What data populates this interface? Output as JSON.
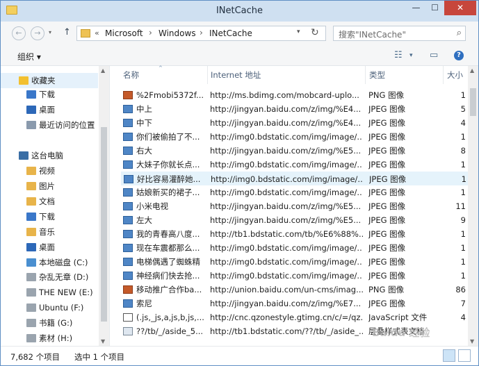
{
  "window": {
    "title": "INetCache"
  },
  "titlebar": {
    "min": "—",
    "max": "☐",
    "close": "✕"
  },
  "address": {
    "back": "←",
    "forward": "→",
    "up": "↑",
    "chevron": "«",
    "crumbs": [
      "Microsoft",
      "Windows",
      "INetCache"
    ],
    "separator": "›",
    "refresh": "↻",
    "dropdown": "▾"
  },
  "search": {
    "placeholder": "搜索\"INetCache\"",
    "icon": "⌕"
  },
  "toolbar": {
    "organize": "组织 ▾",
    "help": "?"
  },
  "nav": {
    "items": [
      {
        "label": "收藏夹",
        "icon": "star-icon",
        "color": "#f2c030"
      },
      {
        "label": "下载",
        "icon": "download-folder-icon",
        "color": "#3a77c9"
      },
      {
        "label": "桌面",
        "icon": "desktop-icon",
        "color": "#2d68b8"
      },
      {
        "label": "最近访问的位置",
        "icon": "recent-places-icon",
        "color": "#8a9aad"
      },
      {
        "label": "这台电脑",
        "icon": "computer-icon",
        "color": "#3a6ea5"
      },
      {
        "label": "视频",
        "icon": "videos-folder-icon",
        "color": "#e8b44a"
      },
      {
        "label": "图片",
        "icon": "pictures-folder-icon",
        "color": "#e8b44a"
      },
      {
        "label": "文档",
        "icon": "documents-folder-icon",
        "color": "#e8b44a"
      },
      {
        "label": "下载",
        "icon": "downloads-folder-icon",
        "color": "#3a77c9"
      },
      {
        "label": "音乐",
        "icon": "music-folder-icon",
        "color": "#e8b44a"
      },
      {
        "label": "桌面",
        "icon": "desktop-folder-icon",
        "color": "#2d68b8"
      },
      {
        "label": "本地磁盘 (C:)",
        "icon": "local-disk-icon",
        "color": "#4a8fd0"
      },
      {
        "label": "杂乱无章 (D:)",
        "icon": "drive-icon",
        "color": "#9aa4ae"
      },
      {
        "label": "THE NEW (E:)",
        "icon": "drive-icon",
        "color": "#9aa4ae"
      },
      {
        "label": "Ubuntu (F:)",
        "icon": "drive-icon",
        "color": "#9aa4ae"
      },
      {
        "label": "书籍 (G:)",
        "icon": "drive-icon",
        "color": "#9aa4ae"
      },
      {
        "label": "素材 (H:)",
        "icon": "drive-icon",
        "color": "#9aa4ae"
      }
    ]
  },
  "columns": {
    "name": "名称",
    "url": "Internet 地址",
    "type": "类型",
    "size": "大小",
    "sort": "^"
  },
  "rows": [
    {
      "name": "%2Fmobi5372f...",
      "url": "http://ms.bdimg.com/mobcard-uplo...",
      "type": "PNG 图像",
      "size": "1",
      "icon": "png"
    },
    {
      "name": "中上",
      "url": "http://jingyan.baidu.com/z/img/%E4...",
      "type": "JPEG 图像",
      "size": "5",
      "icon": "jpg"
    },
    {
      "name": "中下",
      "url": "http://jingyan.baidu.com/z/img/%E4...",
      "type": "JPEG 图像",
      "size": "4",
      "icon": "jpg"
    },
    {
      "name": "你们被偷拍了不...",
      "url": "http://img0.bdstatic.com/img/image/...",
      "type": "JPEG 图像",
      "size": "1",
      "icon": "jpg"
    },
    {
      "name": "右大",
      "url": "http://jingyan.baidu.com/z/img/%E5...",
      "type": "JPEG 图像",
      "size": "8",
      "icon": "jpg"
    },
    {
      "name": "大妹子你就长点...",
      "url": "http://img0.bdstatic.com/img/image/...",
      "type": "JPEG 图像",
      "size": "1",
      "icon": "jpg"
    },
    {
      "name": "好比容易灌醉她...",
      "url": "http://img0.bdstatic.com/img/image/...",
      "type": "JPEG 图像",
      "size": "1",
      "icon": "jpg",
      "selected": true
    },
    {
      "name": "姑娘新买的裙子...",
      "url": "http://img0.bdstatic.com/img/image/...",
      "type": "JPEG 图像",
      "size": "1",
      "icon": "jpg"
    },
    {
      "name": "小米电视",
      "url": "http://jingyan.baidu.com/z/img/%E5...",
      "type": "JPEG 图像",
      "size": "11",
      "icon": "jpg"
    },
    {
      "name": "左大",
      "url": "http://jingyan.baidu.com/z/img/%E5...",
      "type": "JPEG 图像",
      "size": "9",
      "icon": "jpg"
    },
    {
      "name": "我的青春高八度...",
      "url": "http://tb1.bdstatic.com/tb/%E6%88%...",
      "type": "JPEG 图像",
      "size": "1",
      "icon": "jpg"
    },
    {
      "name": "现在车震都那么...",
      "url": "http://img0.bdstatic.com/img/image/...",
      "type": "JPEG 图像",
      "size": "1",
      "icon": "jpg"
    },
    {
      "name": "电梯偶遇了蜘蛛精",
      "url": "http://img0.bdstatic.com/img/image/...",
      "type": "JPEG 图像",
      "size": "1",
      "icon": "jpg"
    },
    {
      "name": "神经病们快去抢...",
      "url": "http://img0.bdstatic.com/img/image/...",
      "type": "JPEG 图像",
      "size": "1",
      "icon": "jpg"
    },
    {
      "name": "移动推广合作bа...",
      "url": "http://union.baidu.com/un-cms/imag...",
      "type": "PNG 图像",
      "size": "86",
      "icon": "png"
    },
    {
      "name": "索尼",
      "url": "http://jingyan.baidu.com/z/img/%E7...",
      "type": "JPEG 图像",
      "size": "7",
      "icon": "jpg"
    },
    {
      "name": "(.js,_js,a,js,b,js,...",
      "url": "http://cnc.qzonestyle.gtimg.cn/c/=/qz...",
      "type": "JavaScript 文件",
      "size": "4",
      "icon": "js"
    },
    {
      "name": "??/tb/_/aside_5...",
      "url": "http://tb1.bdstatic.com/??/tb/_/aside_...",
      "type": "层叠样式表文档",
      "size": "",
      "icon": "html"
    }
  ],
  "status": {
    "count": "7,682 个项目",
    "selected": "选中 1 个项目"
  },
  "watermark": "Baidu 经验"
}
